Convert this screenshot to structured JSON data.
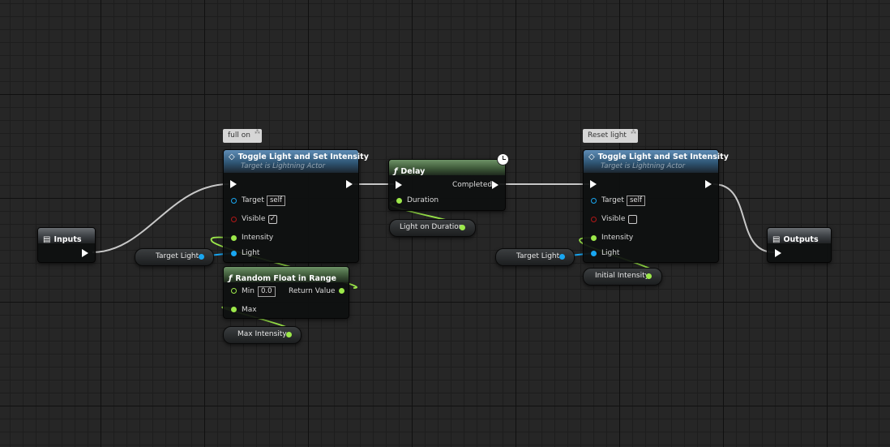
{
  "comments": {
    "full_on": "full on",
    "reset_light": "Reset light"
  },
  "inputs_node": {
    "title": "Inputs"
  },
  "outputs_node": {
    "title": "Outputs"
  },
  "toggle1": {
    "title": "Toggle Light and Set Intensity",
    "subtitle": "Target is Lightning Actor",
    "target_label": "Target",
    "target_value": "self",
    "visible_label": "Visible",
    "visible_checked": true,
    "intensity_label": "Intensity",
    "light_label": "Light"
  },
  "toggle2": {
    "title": "Toggle Light and Set Intensity",
    "subtitle": "Target is Lightning Actor",
    "target_label": "Target",
    "target_value": "self",
    "visible_label": "Visible",
    "visible_checked": false,
    "intensity_label": "Intensity",
    "light_label": "Light"
  },
  "delay": {
    "title": "Delay",
    "completed_label": "Completed",
    "duration_label": "Duration"
  },
  "random": {
    "title": "Random Float in Range",
    "min_label": "Min",
    "min_value": "0.0",
    "max_label": "Max",
    "return_label": "Return Value"
  },
  "variables": {
    "target_light_1": "Target Light",
    "target_light_2": "Target Light",
    "light_on_duration": "Light on Duration",
    "max_intensity": "Max Intensity",
    "initial_intensity": "Initial Intensity"
  },
  "icons": {
    "function": "ƒ",
    "event": "◇",
    "struct": "▤",
    "checkmark": "✓",
    "comment_expand": "⁂"
  },
  "colors": {
    "exec_wire": "#c8c8c8",
    "float_wire": "#9ce84a",
    "object_wire": "#19a6f0",
    "header_blue": "#2f5675",
    "header_green": "#3f5a3a"
  }
}
